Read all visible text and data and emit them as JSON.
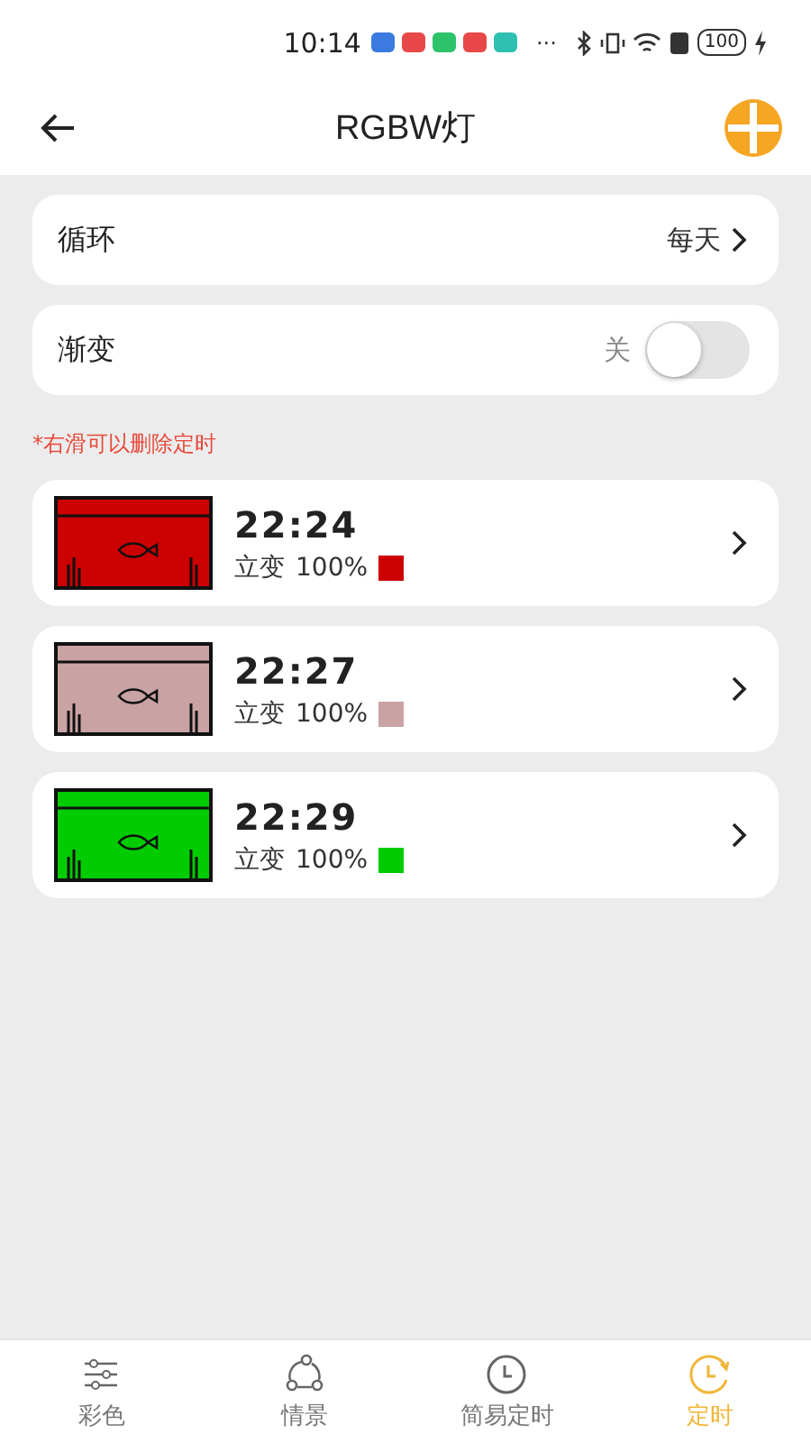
{
  "status_bar": {
    "time": "10:14",
    "more": "···",
    "battery": "100"
  },
  "header": {
    "title": "RGBW灯"
  },
  "settings": [
    {
      "kind": "link",
      "label": "循环",
      "value": "每天"
    },
    {
      "kind": "toggle",
      "label": "渐变",
      "value": "关",
      "on": false
    }
  ],
  "hint": "*右滑可以删除定时",
  "timers": [
    {
      "time": "22:24",
      "mode": "立变",
      "brightness": "100%",
      "color": "#cc0000"
    },
    {
      "time": "22:27",
      "mode": "立变",
      "brightness": "100%",
      "color": "#c9a3a3"
    },
    {
      "time": "22:29",
      "mode": "立变",
      "brightness": "100%",
      "color": "#00cc00"
    }
  ],
  "tabs": [
    {
      "kind": "sliders",
      "label": "彩色",
      "selected": false
    },
    {
      "kind": "scene",
      "label": "情景",
      "selected": false
    },
    {
      "kind": "clock",
      "label": "简易定时",
      "selected": false
    },
    {
      "kind": "timer",
      "label": "定时",
      "selected": true
    }
  ]
}
